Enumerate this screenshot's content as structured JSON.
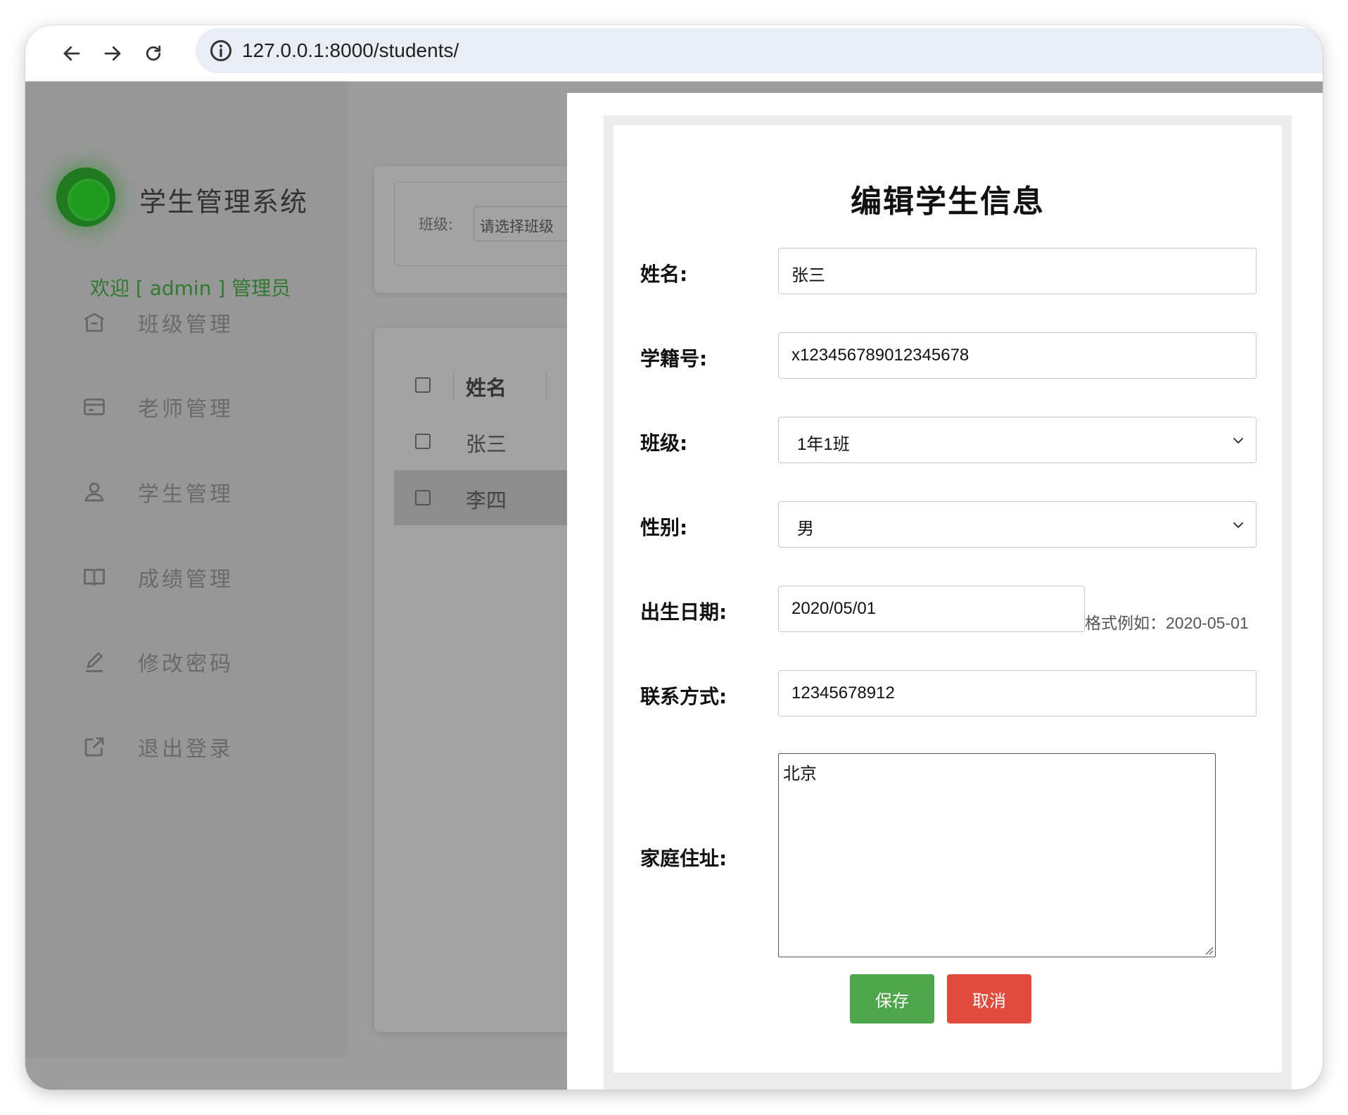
{
  "browser": {
    "url": "127.0.0.1:8000/students/"
  },
  "sidebar": {
    "system_title": "学生管理系统",
    "welcome": "欢迎 [ admin ] 管理员",
    "menu": [
      {
        "label": "班级管理",
        "icon": "building-icon"
      },
      {
        "label": "老师管理",
        "icon": "id-card-icon"
      },
      {
        "label": "学生管理",
        "icon": "user-icon"
      },
      {
        "label": "成绩管理",
        "icon": "book-icon"
      },
      {
        "label": "修改密码",
        "icon": "pencil-icon"
      },
      {
        "label": "退出登录",
        "icon": "logout-icon"
      }
    ]
  },
  "filter": {
    "label": "班级:",
    "select_placeholder": "请选择班级"
  },
  "table": {
    "header": "姓名",
    "rows": [
      "张三",
      "李四"
    ]
  },
  "modal": {
    "title": "编辑学生信息",
    "fields": {
      "name": {
        "label": "姓名:",
        "value": "张三"
      },
      "student_id": {
        "label": "学籍号:",
        "value": "x123456789012345678"
      },
      "class": {
        "label": "班级:",
        "value": "1年1班"
      },
      "gender": {
        "label": "性别:",
        "value": "男"
      },
      "birthday": {
        "label": "出生日期:",
        "value": "2020/05/01",
        "hint": "格式例如：2020-05-01"
      },
      "contact": {
        "label": "联系方式:",
        "value": "12345678912"
      },
      "address": {
        "label": "家庭住址:",
        "value": "北京"
      }
    },
    "save_label": "保存",
    "cancel_label": "取消"
  },
  "colors": {
    "save": "#4ea64a",
    "cancel": "#e24b3b",
    "welcome": "#2f7a2f"
  }
}
